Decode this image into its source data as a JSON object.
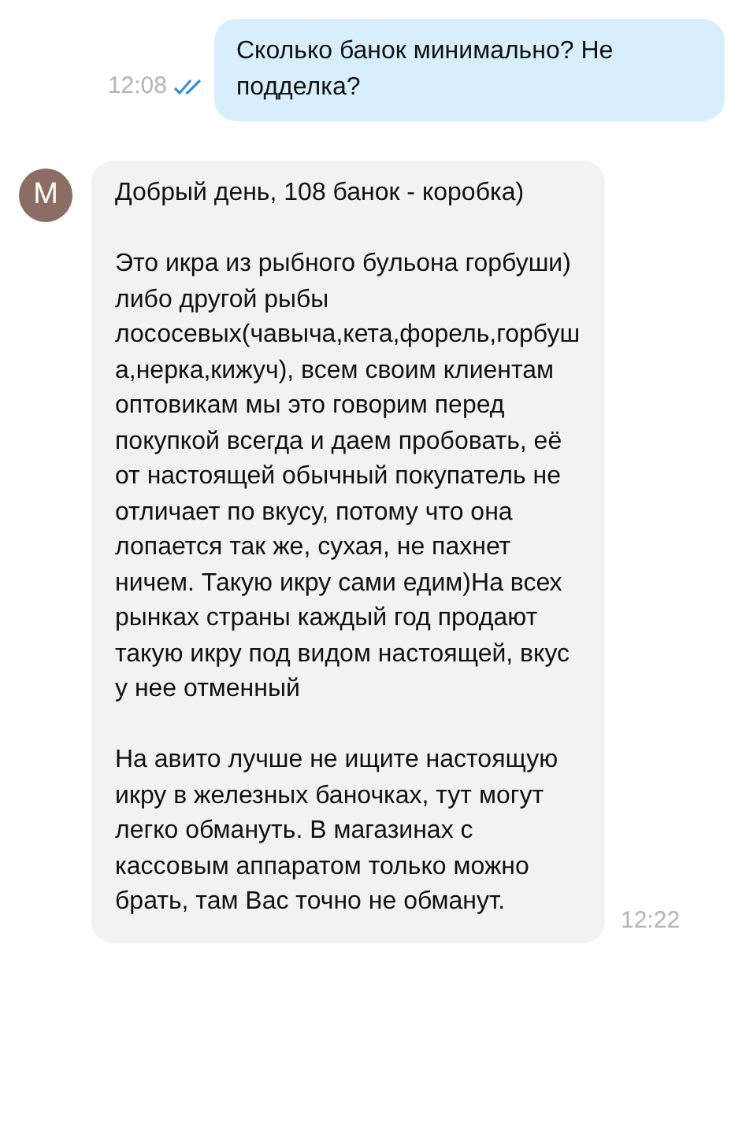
{
  "messages": [
    {
      "kind": "outgoing",
      "text": "Сколько банок минимально? Не подделка?",
      "time": "12:08",
      "read": true
    },
    {
      "kind": "incoming",
      "avatar_letter": "M",
      "paragraphs": [
        "Добрый день, 108 банок - коробка)",
        "Это икра из рыбного бульона горбуши) либо другой рыбы лососевых(чавыча,кета,форель,горбуша,нерка,кижуч), всем своим клиентам оптовикам мы это говорим перед покупкой всегда и даем пробовать, её от настоящей обычный покупатель не отличает по вкусу, потому что она лопается так же, сухая, не пахнет ничем. Такую икру сами едим)На всех рынках страны каждый год продают такую икру под видом настоящей, вкус у нее отменный",
        "На авито лучше не ищите настоящую икру в железных баночках, тут могут легко обмануть. В магазинах с кассовым аппаратом только можно брать, там Вас точно не обманут."
      ],
      "time": "12:22"
    }
  ]
}
